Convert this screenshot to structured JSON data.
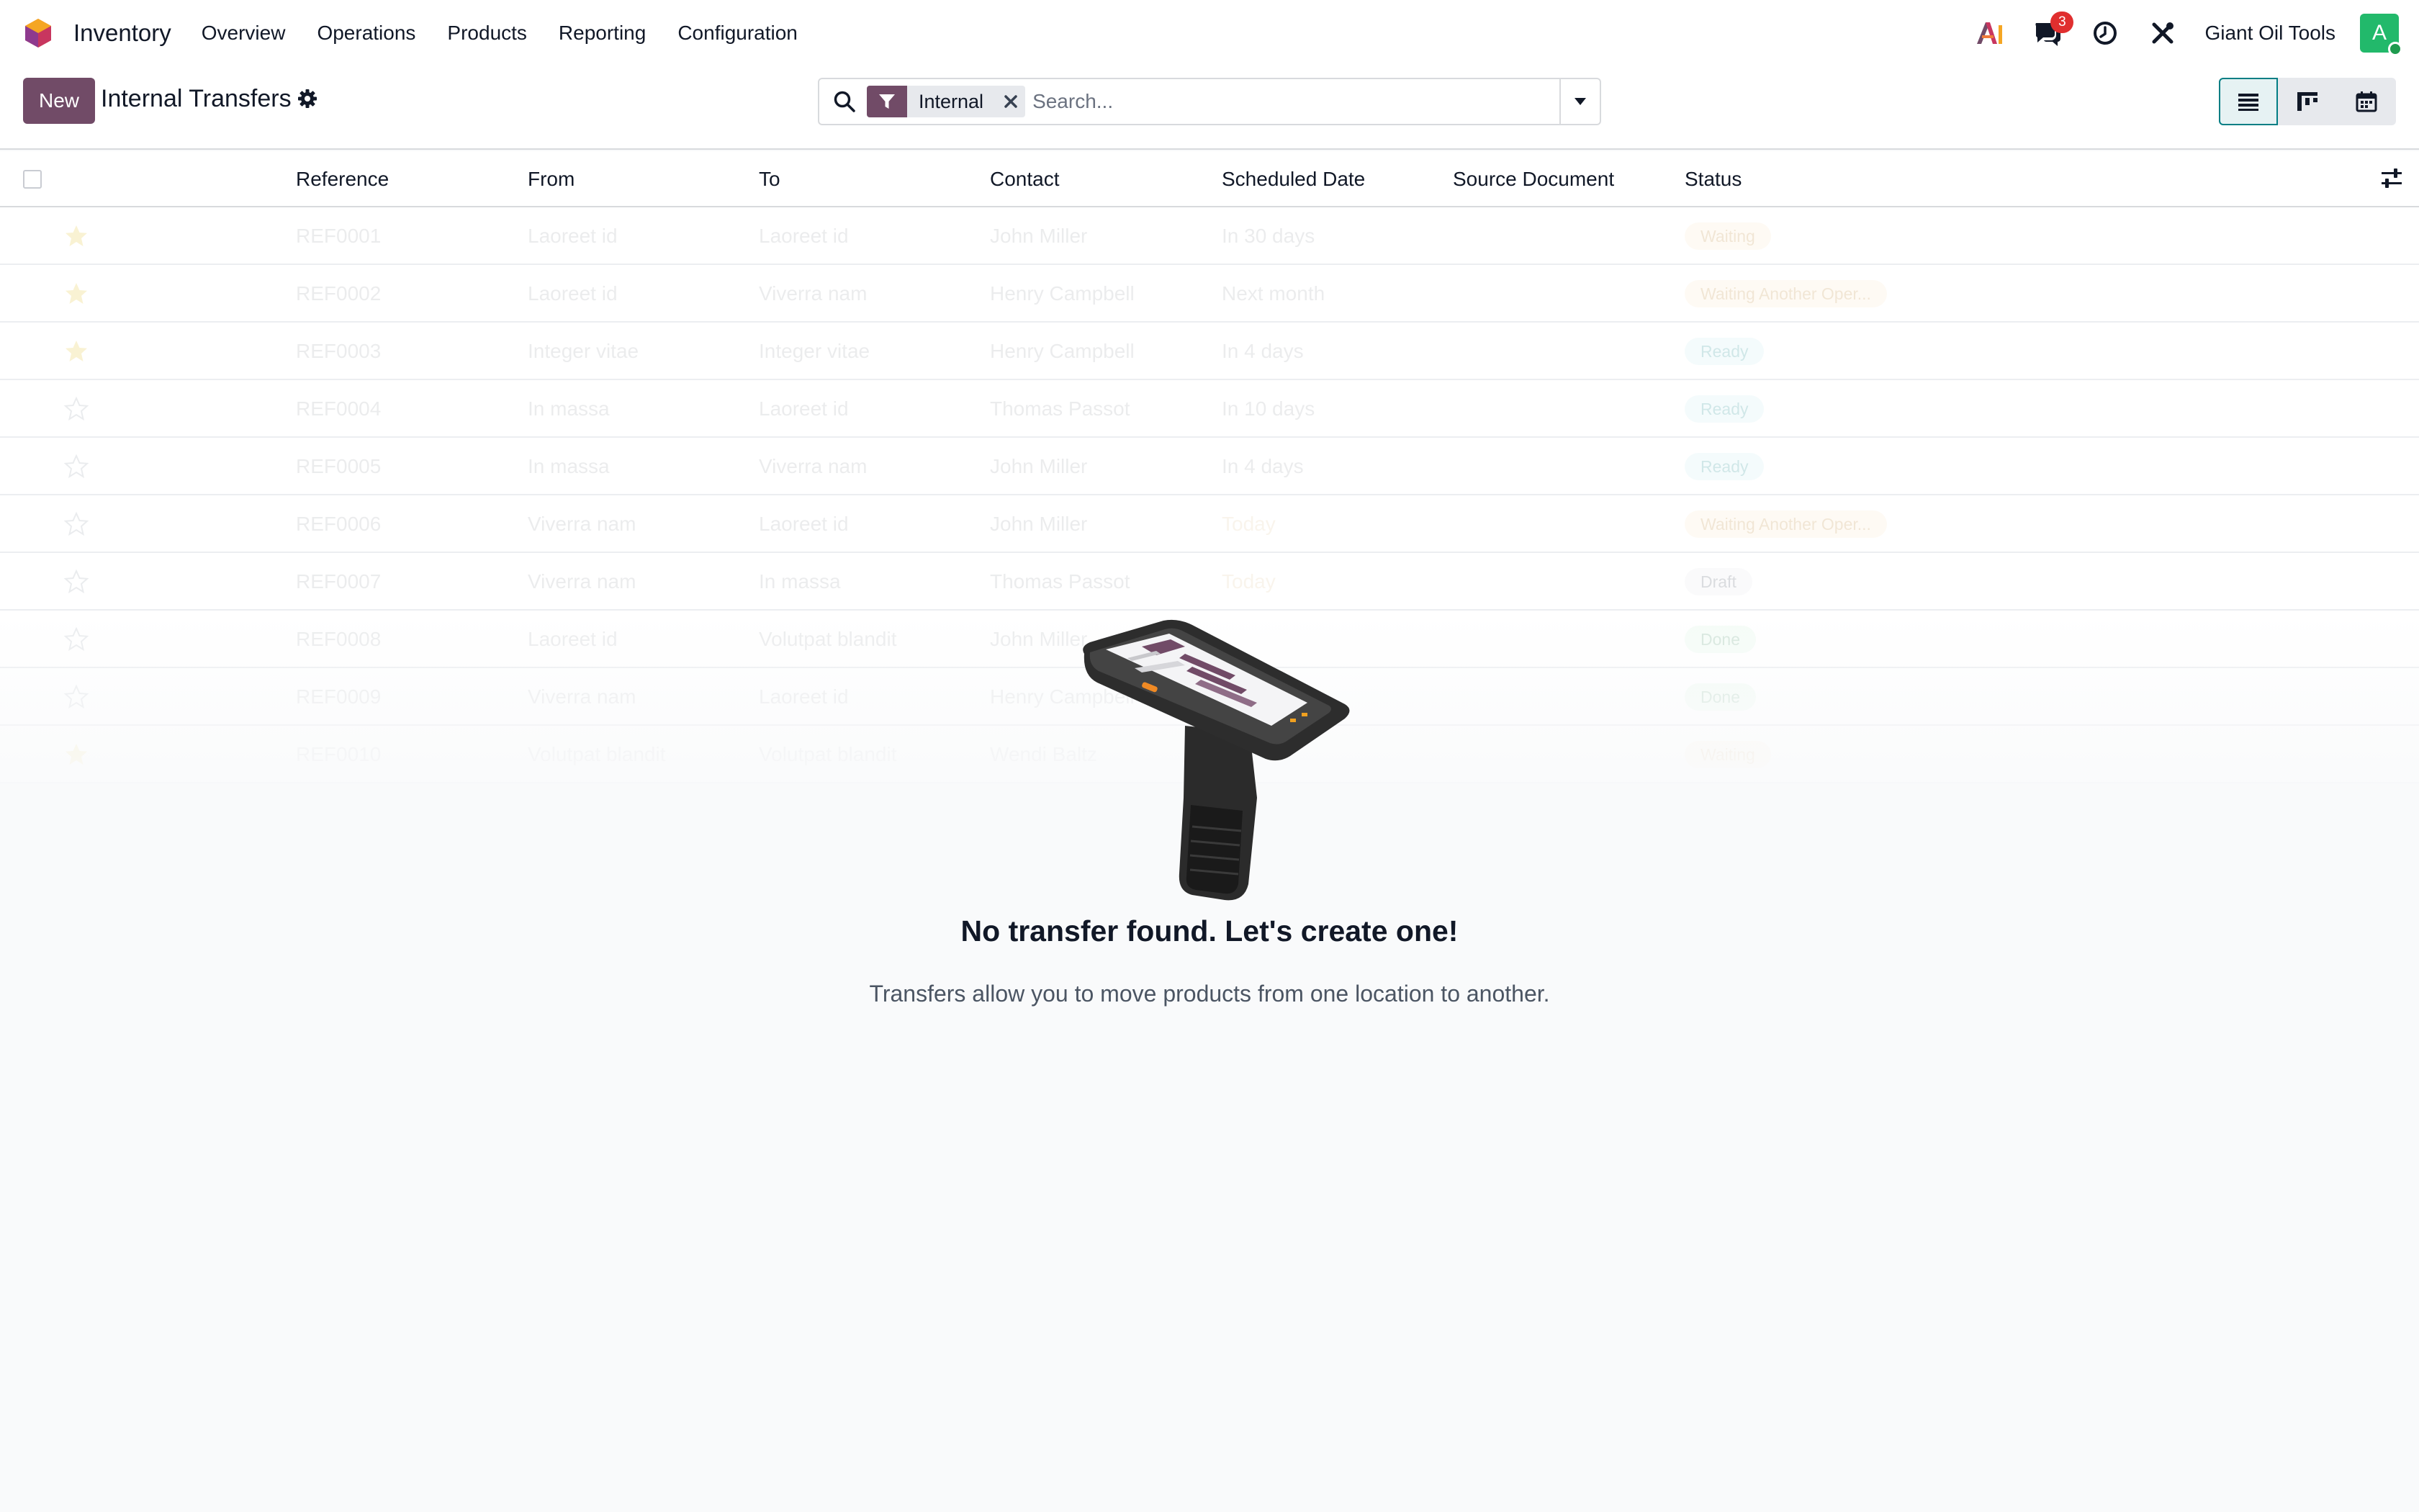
{
  "app": {
    "name": "Inventory"
  },
  "menu": [
    "Overview",
    "Operations",
    "Products",
    "Reporting",
    "Configuration"
  ],
  "systray": {
    "messages_count": "3",
    "company": "Giant Oil Tools",
    "avatar_letter": "A"
  },
  "control_panel": {
    "new_label": "New",
    "title": "Internal Transfers",
    "search": {
      "facet_label": "Internal",
      "placeholder": "Search..."
    },
    "views": [
      "list",
      "kanban",
      "calendar"
    ],
    "active_view": "list"
  },
  "table": {
    "columns": [
      "Reference",
      "From",
      "To",
      "Contact",
      "Scheduled Date",
      "Source Document",
      "Status"
    ],
    "rows": [
      {
        "ref": "REF0001",
        "from": "Laoreet id",
        "to": "Laoreet id",
        "contact": "John Miller",
        "date": "In 30 days",
        "source": "",
        "status": "Waiting",
        "starred": true
      },
      {
        "ref": "REF0002",
        "from": "Laoreet id",
        "to": "Viverra nam",
        "contact": "Henry Campbell",
        "date": "Next month",
        "source": "",
        "status": "Waiting Another Oper...",
        "starred": true
      },
      {
        "ref": "REF0003",
        "from": "Integer vitae",
        "to": "Integer vitae",
        "contact": "Henry Campbell",
        "date": "In 4 days",
        "source": "",
        "status": "Ready",
        "starred": true
      },
      {
        "ref": "REF0004",
        "from": "In massa",
        "to": "Laoreet id",
        "contact": "Thomas Passot",
        "date": "In 10 days",
        "source": "",
        "status": "Ready",
        "starred": false
      },
      {
        "ref": "REF0005",
        "from": "In massa",
        "to": "Viverra nam",
        "contact": "John Miller",
        "date": "In 4 days",
        "source": "",
        "status": "Ready",
        "starred": false
      },
      {
        "ref": "REF0006",
        "from": "Viverra nam",
        "to": "Laoreet id",
        "contact": "John Miller",
        "date": "Today",
        "source": "",
        "status": "Waiting Another Oper...",
        "starred": false
      },
      {
        "ref": "REF0007",
        "from": "Viverra nam",
        "to": "In massa",
        "contact": "Thomas Passot",
        "date": "Today",
        "source": "",
        "status": "Draft",
        "starred": false
      },
      {
        "ref": "REF0008",
        "from": "Laoreet id",
        "to": "Volutpat blandit",
        "contact": "John Miller",
        "date": "",
        "source": "",
        "status": "Done",
        "starred": false
      },
      {
        "ref": "REF0009",
        "from": "Viverra nam",
        "to": "Laoreet id",
        "contact": "Henry Campbell",
        "date": "",
        "source": "",
        "status": "Done",
        "starred": false
      },
      {
        "ref": "REF0010",
        "from": "Volutpat blandit",
        "to": "Volutpat blandit",
        "contact": "Wendi Baltz",
        "date": "",
        "source": "",
        "status": "Waiting",
        "starred": true
      }
    ]
  },
  "helper": {
    "title": "No transfer found. Let's create one!",
    "text": "Transfers allow you to move products from one location to another."
  },
  "colors": {
    "brand": "#714b67",
    "accent": "#017e84",
    "badge": "#e02f2f",
    "avatar": "#22b96b"
  }
}
